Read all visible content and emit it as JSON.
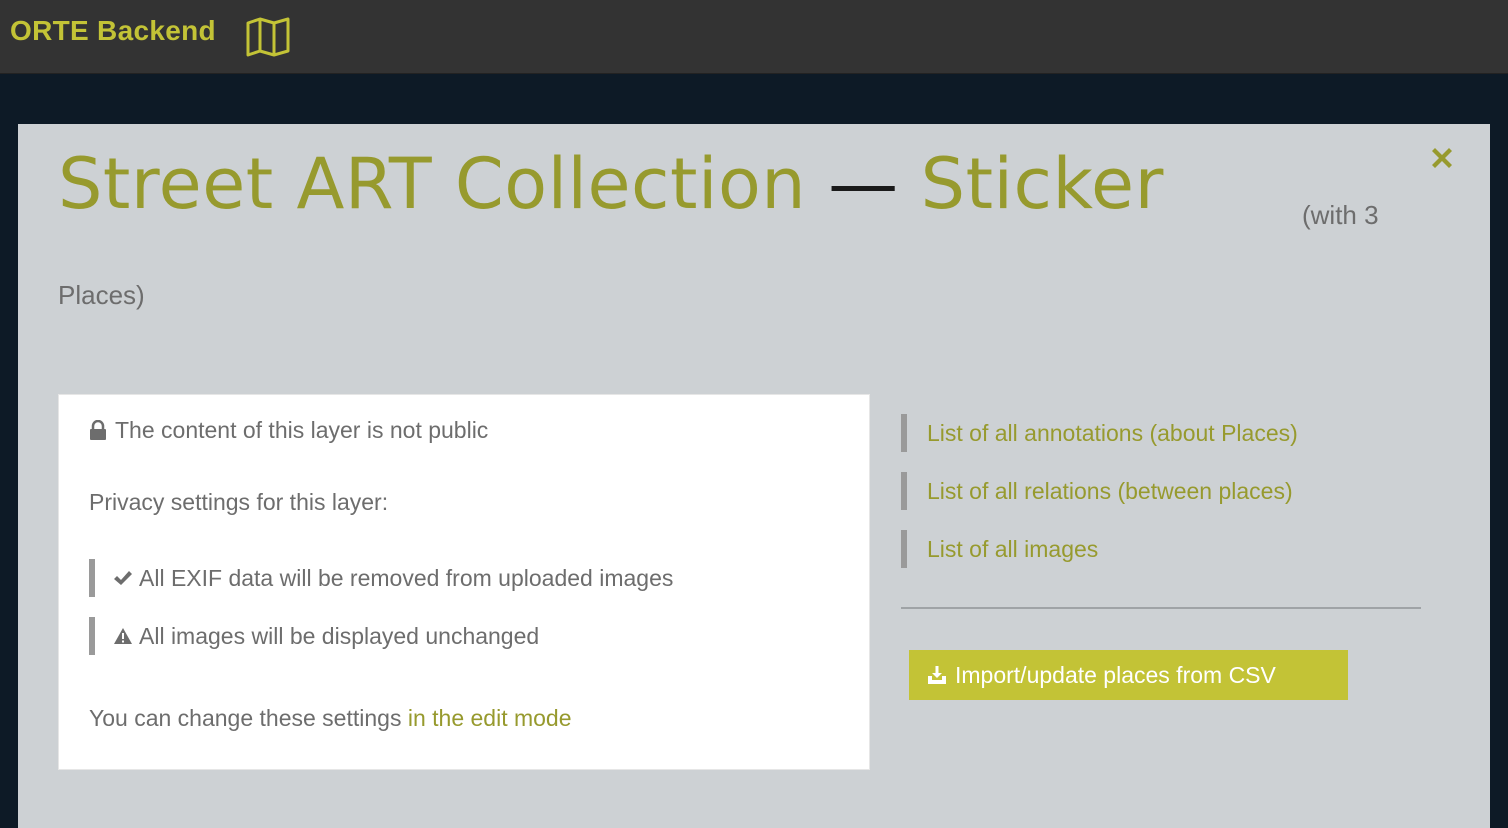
{
  "app": {
    "brand": "ORTE Backend",
    "brand_icon": "map-icon",
    "colors": {
      "accent": "#c3c336",
      "title": "#979a2e",
      "topbar": "#333333",
      "background": "#0d1a26",
      "modal": "#cdd1d4"
    }
  },
  "modal": {
    "close_icon": "close-icon",
    "title_part1": "Street ART Collection",
    "title_dash": "—",
    "title_part2": "Sticker",
    "title_count_a": "(with 3",
    "title_count_b": "Places)"
  },
  "info": {
    "public_status": "The content of this layer is not public",
    "privacy_heading": "Privacy settings for this layer:",
    "exif_setting": "All EXIF data will be removed from uploaded images",
    "images_setting": "All images will be displayed unchanged",
    "change_text": "You can change these settings ",
    "change_link": "in the edit mode"
  },
  "links": [
    {
      "label": "List of all annotations (about Places)"
    },
    {
      "label": "List of all relations (between places)"
    },
    {
      "label": "List of all images"
    }
  ],
  "import_button": {
    "label": "Import/update places from CSV",
    "icon": "import-icon"
  }
}
